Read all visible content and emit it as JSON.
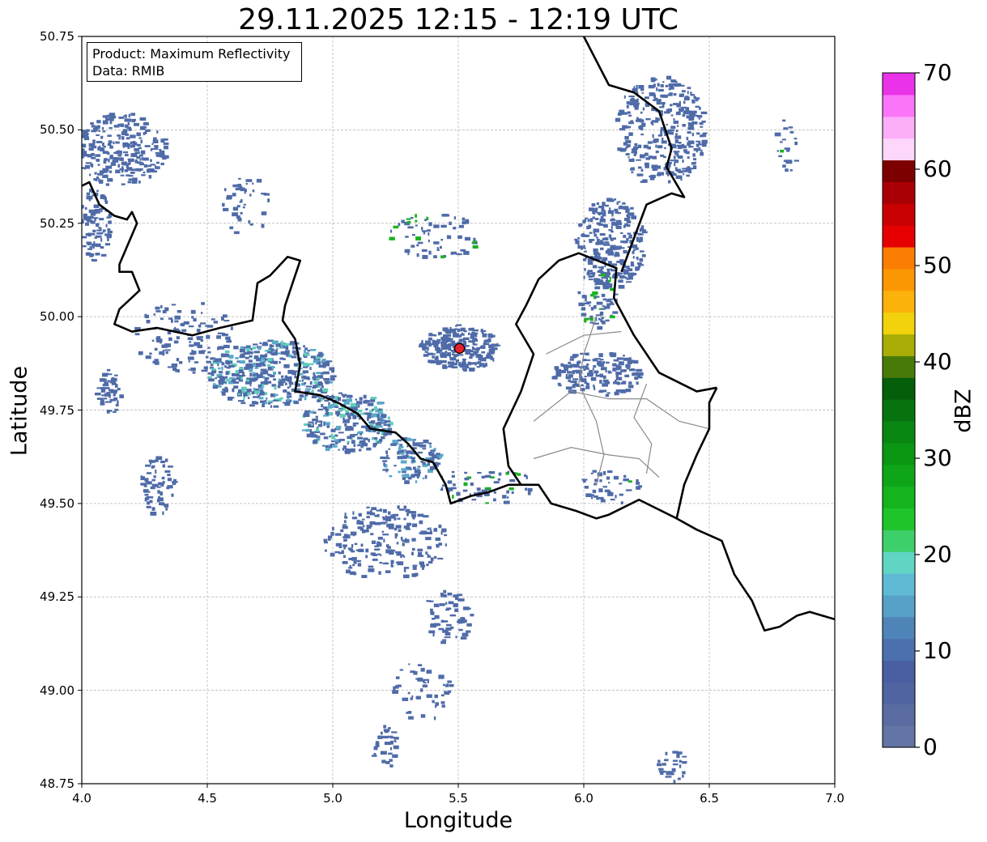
{
  "title": "29.11.2025 12:15 - 12:19 UTC",
  "info_box": {
    "product": "Product: Maximum Reflectivity",
    "data": "Data: RMIB"
  },
  "axes": {
    "xlabel": "Longitude",
    "ylabel": "Latitude",
    "xlim": [
      4.0,
      7.0
    ],
    "ylim": [
      48.75,
      50.75
    ],
    "xticks": [
      "4.0",
      "4.5",
      "5.0",
      "5.5",
      "6.0",
      "6.5",
      "7.0"
    ],
    "yticks": [
      "48.75",
      "49.00",
      "49.25",
      "49.50",
      "49.75",
      "50.00",
      "50.25",
      "50.50",
      "50.75"
    ],
    "grid": true
  },
  "radar_site": {
    "lon": 5.505,
    "lat": 49.915,
    "color": "#e8202a"
  },
  "colorbar": {
    "label": "dBZ",
    "range": [
      0,
      70
    ],
    "ticks": [
      "0",
      "10",
      "20",
      "30",
      "40",
      "50",
      "60",
      "70"
    ],
    "colors": [
      "#6375a4",
      "#5a6ca2",
      "#4f64a0",
      "#4a5fa1",
      "#4c70ae",
      "#4f84b8",
      "#57a0c8",
      "#61bad4",
      "#60d5c4",
      "#3dcf6a",
      "#1ec42a",
      "#15b41e",
      "#0ea618",
      "#0b9614",
      "#0a8612",
      "#07730e",
      "#055e0a",
      "#487a0a",
      "#a9ad05",
      "#f2d20d",
      "#fbb20a",
      "#fc9704",
      "#fb7d02",
      "#e70000",
      "#c80002",
      "#a90006",
      "#7d0000",
      "#fdd6fb",
      "#fcaef9",
      "#fb75f9",
      "#ea33e9"
    ]
  },
  "echo_colors": {
    "weak": "#4f6ba8",
    "moderate": "#5aa9c9",
    "teal": "#5fcfbc",
    "green": "#19b21f"
  }
}
